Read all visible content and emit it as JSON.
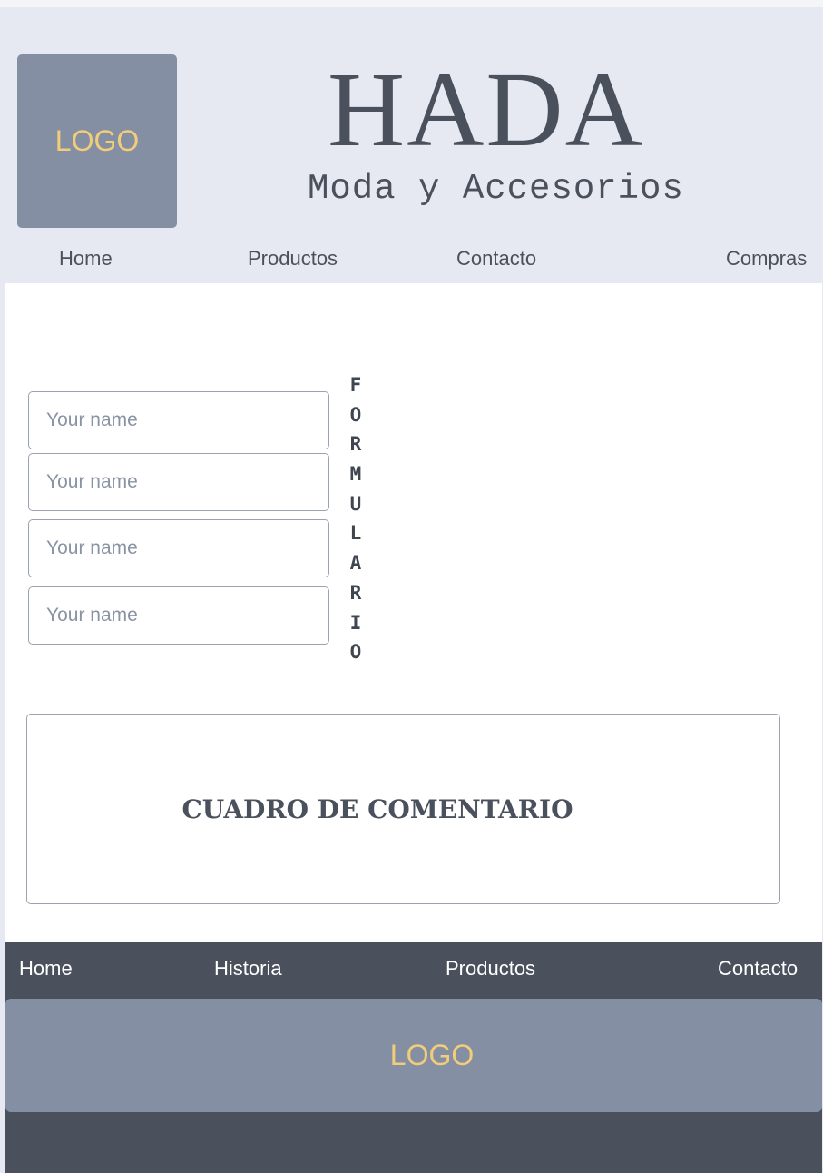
{
  "header": {
    "logo_text": "LOGO",
    "title": "HADA",
    "subtitle": "Moda y Accesorios",
    "nav": [
      "Home",
      "Productos",
      "Contacto",
      "Compras"
    ]
  },
  "form": {
    "vertical_title": [
      "F",
      "O",
      "R",
      "M",
      "U",
      "L",
      "A",
      "R",
      "I",
      "O"
    ],
    "fields": [
      {
        "placeholder": "Your name",
        "value": ""
      },
      {
        "placeholder": "Your name",
        "value": ""
      },
      {
        "placeholder": "Your name",
        "value": ""
      },
      {
        "placeholder": "Your name",
        "value": ""
      }
    ],
    "comment_label": "CUADRO DE COMENTARIO"
  },
  "footer": {
    "nav": [
      "Home",
      "Historia",
      "Productos",
      "Contacto"
    ],
    "logo_text": "LOGO"
  },
  "colors": {
    "header_bg": "#e6e9f1",
    "logo_bg": "#858fa3",
    "logo_text": "#f1cd79",
    "text_dark": "#4a515c",
    "footer_bg": "#4a515c"
  }
}
